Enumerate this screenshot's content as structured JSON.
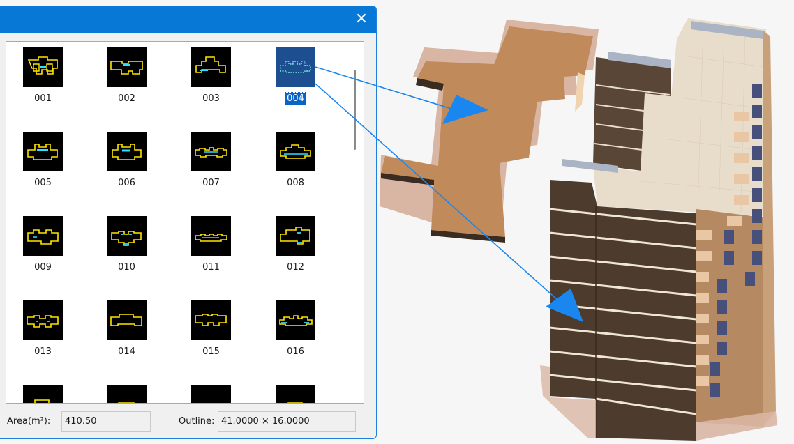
{
  "window": {
    "close_glyph": "✕"
  },
  "items": [
    {
      "label": "001"
    },
    {
      "label": "002"
    },
    {
      "label": "003"
    },
    {
      "label": "004"
    },
    {
      "label": "005"
    },
    {
      "label": "006"
    },
    {
      "label": "007"
    },
    {
      "label": "008"
    },
    {
      "label": "009"
    },
    {
      "label": "010"
    },
    {
      "label": "011"
    },
    {
      "label": "012"
    },
    {
      "label": "013"
    },
    {
      "label": "014"
    },
    {
      "label": "015"
    },
    {
      "label": "016"
    }
  ],
  "selected_item": "004",
  "footer": {
    "area_label": "Area(m²):",
    "area_value": "410.50",
    "outline_label": "Outline:",
    "outline_value": "41.0000 × 16.0000"
  },
  "colors": {
    "accent": "#0778d6",
    "outline_yellow": "#ffe600",
    "outline_cyan": "#2de0ff",
    "arrow": "#1a86f0"
  }
}
